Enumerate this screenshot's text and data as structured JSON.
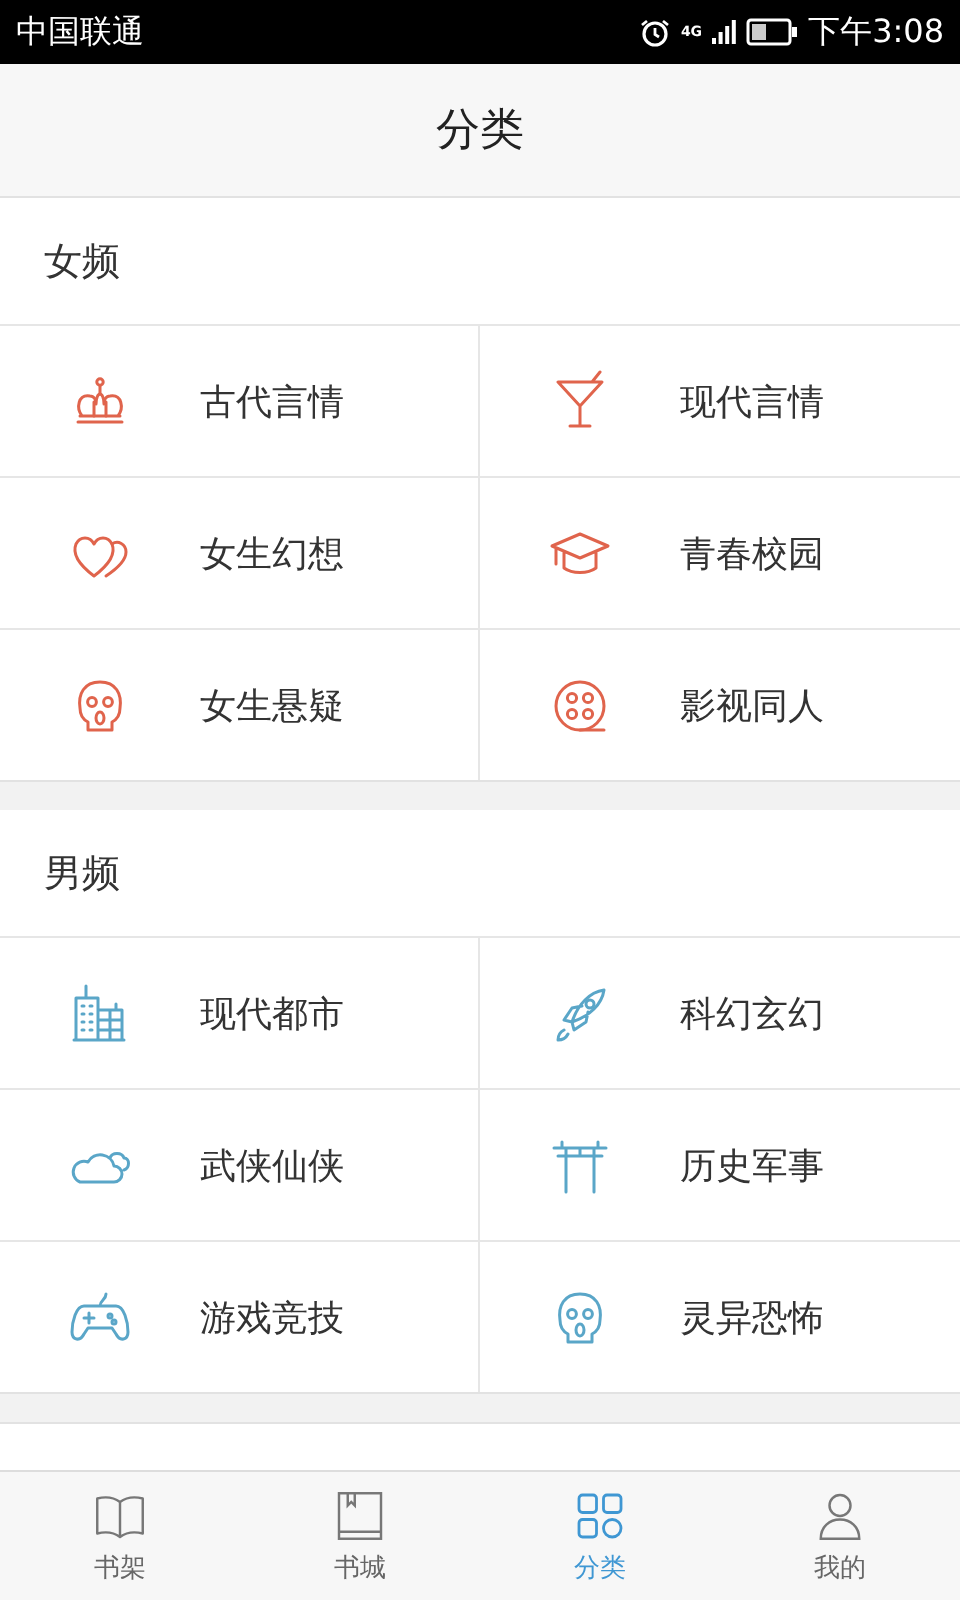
{
  "status_bar": {
    "carrier": "中国联通",
    "network": "4G",
    "time": "下午3:08"
  },
  "header": {
    "title": "分类"
  },
  "sections": [
    {
      "title": "女频",
      "color": "#e0644c",
      "items": [
        {
          "label": "古代言情"
        },
        {
          "label": "现代言情"
        },
        {
          "label": "女生幻想"
        },
        {
          "label": "青春校园"
        },
        {
          "label": "女生悬疑"
        },
        {
          "label": "影视同人"
        }
      ]
    },
    {
      "title": "男频",
      "color": "#5aa6c8",
      "items": [
        {
          "label": "现代都市"
        },
        {
          "label": "科幻玄幻"
        },
        {
          "label": "武侠仙侠"
        },
        {
          "label": "历史军事"
        },
        {
          "label": "游戏竞技"
        },
        {
          "label": "灵异恐怖"
        }
      ]
    }
  ],
  "bottom_nav": [
    {
      "label": "书架",
      "selected": false
    },
    {
      "label": "书城",
      "selected": false
    },
    {
      "label": "分类",
      "selected": true
    },
    {
      "label": "我的",
      "selected": false
    }
  ]
}
